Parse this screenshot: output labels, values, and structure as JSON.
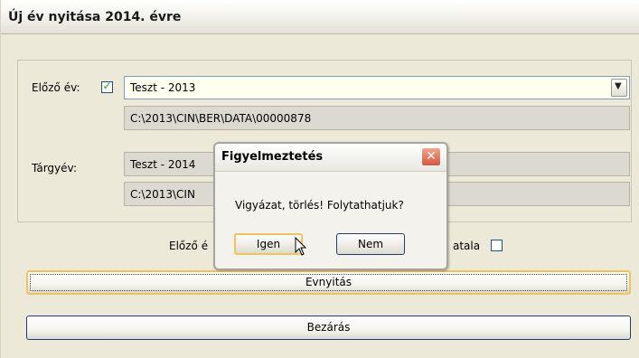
{
  "window": {
    "title": "Új év nyitása 2014. évre"
  },
  "previous_year": {
    "label": "Előző év:",
    "checked": true,
    "selected": "Teszt - 2013",
    "path": "C:\\2013\\CIN\\BER\\DATA\\00000878"
  },
  "subject_year": {
    "label": "Tárgyév:",
    "name": "Teszt - 2014",
    "path": "C:\\2013\\CIN"
  },
  "row_options": {
    "left_text": "Előző é",
    "right_text": "atala"
  },
  "buttons": {
    "open": "Evnyitás",
    "close": "Bezárás"
  },
  "dialog": {
    "title": "Figyelmeztetés",
    "message": "Vigyázat, törlés! Folytathatjuk?",
    "yes": "Igen",
    "no": "Nem"
  },
  "colors": {
    "checkmark": "#21a121",
    "focus_border": "#f2c35c",
    "close_button": "#d8553a"
  }
}
